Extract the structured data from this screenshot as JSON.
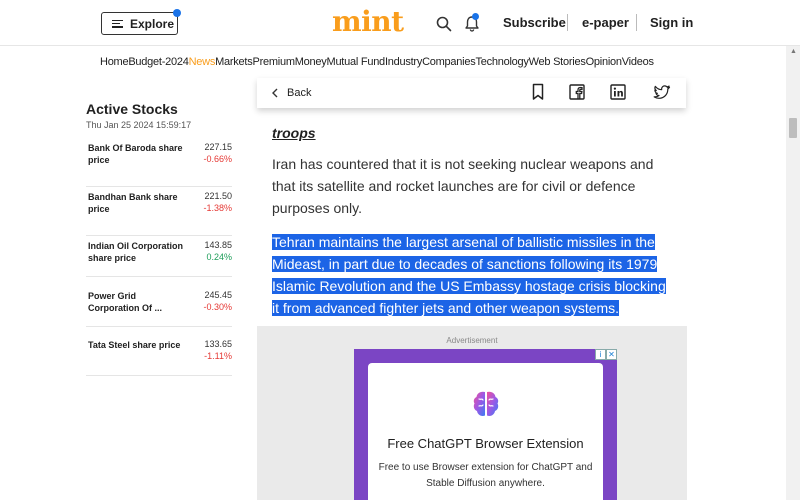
{
  "header": {
    "explore_label": "Explore",
    "logo_text": "mint",
    "subscribe_label": "Subscribe",
    "epaper_label": "e-paper",
    "signin_label": "Sign in",
    "accent_color": "#f99d1c"
  },
  "nav": {
    "items": [
      "Home",
      "Budget-2024",
      "News",
      "Markets",
      "Premium",
      "Money",
      "Mutual Fund",
      "Industry",
      "Companies",
      "Technology",
      "Web Stories",
      "Opinion",
      "Videos"
    ],
    "active": "News"
  },
  "stocks": {
    "title": "Active Stocks",
    "date": "Thu Jan 25 2024 15:59:17",
    "rows": [
      {
        "name": "Bank Of Baroda share price",
        "price": "227.15",
        "change": "-0.66%",
        "direction": "down"
      },
      {
        "name": "Bandhan Bank share price",
        "price": "221.50",
        "change": "-1.38%",
        "direction": "down"
      },
      {
        "name": "Indian Oil Corporation share price",
        "price": "143.85",
        "change": "0.24%",
        "direction": "up"
      },
      {
        "name": "Power Grid Corporation Of ...",
        "price": "245.45",
        "change": "-0.30%",
        "direction": "down"
      },
      {
        "name": "Tata Steel share price",
        "price": "133.65",
        "change": "-1.11%",
        "direction": "down"
      }
    ]
  },
  "share_bar": {
    "back_label": "Back",
    "icons": [
      "bookmark-icon",
      "facebook-icon",
      "linkedin-icon",
      "twitter-icon"
    ]
  },
  "article": {
    "prev_link_tail": "troops",
    "para1": "Iran has countered that it is not seeking nuclear weapons and that its satellite and rocket launches are for civil or defence purposes only.",
    "para2": "Tehran maintains the largest arsenal of ballistic missiles in the Mideast, in part due to decades of sanctions following its 1979 Islamic Revolution and the US Embassy hostage crisis blocking it from advanced fighter jets and other weapon systems.",
    "selection_color": "#1c64e6"
  },
  "ad": {
    "label": "Advertisement",
    "title": "Free ChatGPT Browser Extension",
    "description": "Free to use Browser extension for ChatGPT and Stable Diffusion anywhere.",
    "frame_color": "#7b45c4"
  }
}
